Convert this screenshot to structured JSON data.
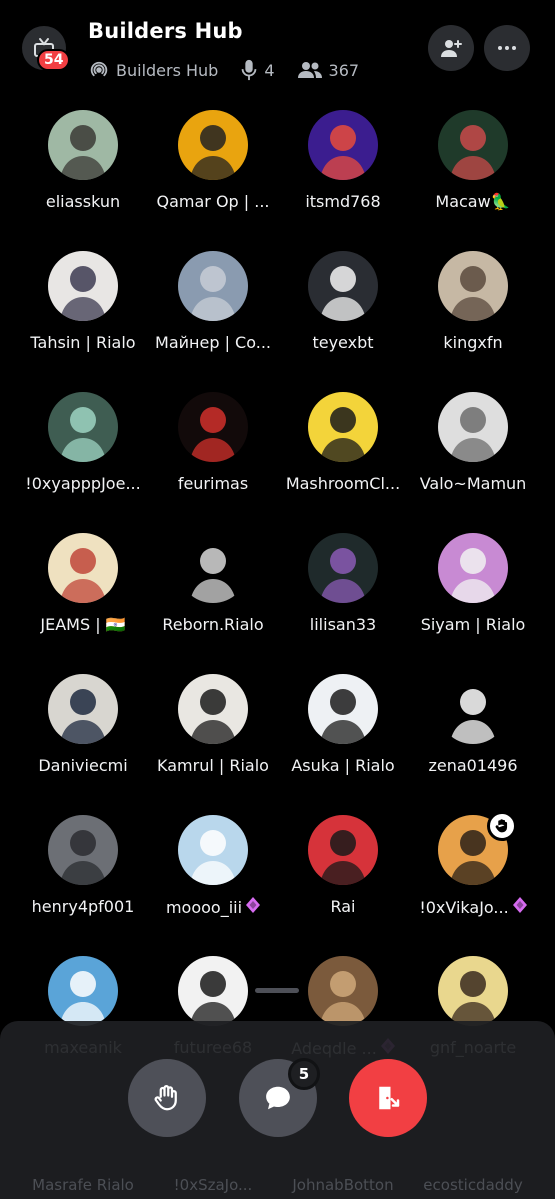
{
  "header": {
    "title": "Builders Hub",
    "notif_count": "54",
    "server_name": "Builders Hub",
    "speakers_count": "4",
    "listeners_count": "367"
  },
  "participants": [
    {
      "name": "eliasskun",
      "avatar": "anime-glasses-boy",
      "colors": [
        "#9fb8a4",
        "#3b3a36"
      ]
    },
    {
      "name": "Qamar Op | ...",
      "avatar": "hooded-logo",
      "colors": [
        "#e9a40f",
        "#222"
      ]
    },
    {
      "name": "itsmd768",
      "avatar": "neon-bird",
      "colors": [
        "#3b1d8f",
        "#e84b3c"
      ]
    },
    {
      "name": "Macaw🦜",
      "avatar": "anime-swordsman",
      "colors": [
        "#1f3a2a",
        "#c94a4a"
      ]
    },
    {
      "name": "Tahsin | Rialo",
      "avatar": "anime-silver-hair",
      "colors": [
        "#e8e6e4",
        "#3d3b52"
      ]
    },
    {
      "name": "Майнер | Co...",
      "avatar": "car",
      "colors": [
        "#8a9bb0",
        "#c7cdd6"
      ]
    },
    {
      "name": "teyexbt",
      "avatar": "panda-santa",
      "colors": [
        "#2a2d33",
        "#f4f4f4"
      ]
    },
    {
      "name": "kingxfn",
      "avatar": "man-portrait",
      "colors": [
        "#c6b8a4",
        "#5a4a3e"
      ]
    },
    {
      "name": "!0xyapppJoe...",
      "avatar": "statue-liberty",
      "colors": [
        "#3f5d52",
        "#9dd3c2"
      ]
    },
    {
      "name": "feurimas",
      "avatar": "red-cube",
      "colors": [
        "#120a0a",
        "#d1302b"
      ]
    },
    {
      "name": "MashroomCl...",
      "avatar": "cartoon-guy",
      "colors": [
        "#f3d43a",
        "#1a1a1a"
      ]
    },
    {
      "name": "Valo~Mamun",
      "avatar": "anime-sunglasses",
      "colors": [
        "#dedede",
        "#6d6d6d"
      ]
    },
    {
      "name": "JEAMS  |  🇮🇳",
      "avatar": "pixel-dog",
      "colors": [
        "#efe1c0",
        "#c0463a"
      ]
    },
    {
      "name": "Reborn.Rialo",
      "avatar": "mask-hood",
      "colors": [
        "#000000",
        "#d8d8d8"
      ]
    },
    {
      "name": "lilisan33",
      "avatar": "witch-dark",
      "colors": [
        "#1f2a2b",
        "#8b5bb5"
      ]
    },
    {
      "name": "Siyam | Rialo",
      "avatar": "anime-hoodie",
      "colors": [
        "#c88ad3",
        "#f1f1f1"
      ]
    },
    {
      "name": "Daniviecmi",
      "avatar": "anime-dark-hair",
      "colors": [
        "#d8d6d0",
        "#1f2a40"
      ]
    },
    {
      "name": "Kamrul | Rialo",
      "avatar": "anime-suit",
      "colors": [
        "#e9e7e2",
        "#1b1b1b"
      ]
    },
    {
      "name": "Asuka | Rialo",
      "avatar": "anime-girl",
      "colors": [
        "#eef1f4",
        "#1c1c1c"
      ]
    },
    {
      "name": "zena01496",
      "avatar": "white-cat-cartoon",
      "colors": [
        "#000000",
        "#ffffff"
      ]
    },
    {
      "name": "henry4pf001",
      "avatar": "man-cloud",
      "colors": [
        "#6c6f75",
        "#2b2d31"
      ]
    },
    {
      "name": "moooo_iii",
      "avatar": "white-cat",
      "colors": [
        "#b9d7ec",
        "#ffffff"
      ],
      "nitro": true
    },
    {
      "name": "Rai",
      "avatar": "l-anime",
      "colors": [
        "#d6333a",
        "#1a1a1a"
      ]
    },
    {
      "name": "!0xVikaJo...",
      "avatar": "sunset-group",
      "colors": [
        "#e7a14a",
        "#2b2118"
      ],
      "nitro": true,
      "hand_raised": true
    },
    {
      "name": "maxeanik",
      "avatar": "anime-cat-hat",
      "colors": [
        "#5aa4d8",
        "#ffffff"
      ]
    },
    {
      "name": "futuree68",
      "avatar": "curly-hair",
      "colors": [
        "#f2f2f2",
        "#1a1a1a"
      ]
    },
    {
      "name": "Adeqdle ...",
      "avatar": "bear-sofa",
      "colors": [
        "#7b5a3c",
        "#d0a97a"
      ],
      "nitro": true
    },
    {
      "name": "gnf_noarte",
      "avatar": "anime-boy-cap",
      "colors": [
        "#e9d78e",
        "#3a2a1e"
      ]
    }
  ],
  "ghost_row": [
    "Masrafe Rialo",
    "!0xSzaJo...",
    "JohnabBotton",
    "ecosticdaddy"
  ],
  "controls": {
    "raise_hand_label": "raise-hand",
    "chat_unread": "5",
    "leave_label": "leave"
  },
  "colors": {
    "accent_red": "#f23f43",
    "nitro_pink": "#d66bf0"
  }
}
